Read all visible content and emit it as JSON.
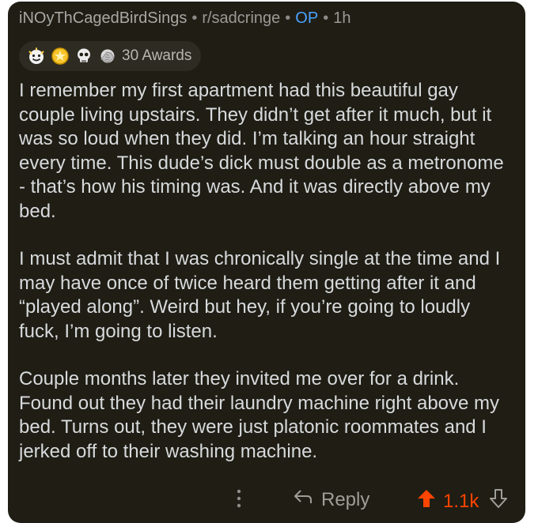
{
  "comment": {
    "username": "iNOyThCagedBirdSings",
    "subreddit": "r/sadcringe",
    "op_badge": "OP",
    "timestamp": "1h",
    "separator": "•",
    "awards": {
      "icons": [
        "wholesome-award-icon",
        "gold-award-icon",
        "skull-award-icon",
        "facepalm-award-icon"
      ],
      "count_label": "30 Awards"
    },
    "paragraphs": [
      "I remember my first apartment had this beautiful gay couple living upstairs. They didn’t get after it much, but it was so loud when they did. I’m talking an hour straight every time. This dude’s dick must double as a metronome - that’s how his timing was. And it was directly above my bed.",
      "I must admit that I was chronically single at the time and I may have once of twice heard them getting after it and “played along”. Weird but hey, if you’re going to loudly fuck, I’m going to listen.",
      "Couple months later they invited me over for a drink. Found out they had their laundry machine right above my bed. Turns out, they were just platonic roommates and I jerked off to their washing machine."
    ],
    "actions": {
      "more_icon": "more-vertical-icon",
      "reply_label": "Reply",
      "score": "1.1k"
    }
  },
  "colors": {
    "card_bg": "#1f1d14",
    "text": "#d7dadc",
    "muted": "#9a9a96",
    "op": "#4aa3ff",
    "upvote": "#ff4500"
  }
}
